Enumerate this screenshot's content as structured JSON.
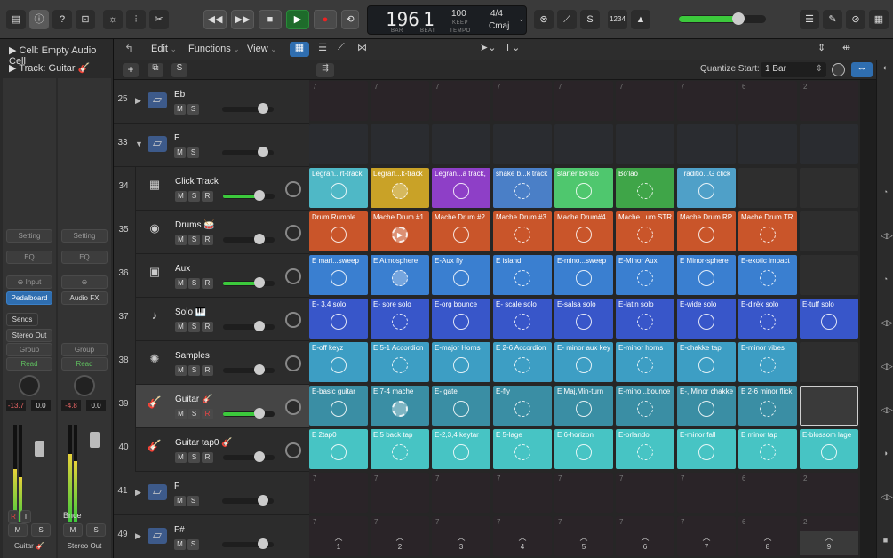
{
  "transport": {
    "bar": "196",
    "beat": "1",
    "bar_label": "BAR",
    "beat_label": "BEAT",
    "tempo": "100",
    "tempo_keep": "KEEP",
    "tempo_label": "TEMPO",
    "timesig": "4/4",
    "key": "Cmaj",
    "count_in": "1234",
    "master_volume": 0.68
  },
  "toolbar": {
    "edit": "Edit",
    "functions": "Functions",
    "view": "View"
  },
  "inspector": {
    "cell_label": "Cell: Empty Audio Cell",
    "track_label": "Track:",
    "track_value": "Guitar",
    "track_emoji": "🎸"
  },
  "channel_strip_1": {
    "setting": "Setting",
    "eq": "EQ",
    "input": "Input",
    "plugin": "Pedalboard",
    "sends": "Sends",
    "output": "Stereo Out",
    "group": "Group",
    "automation": "Read",
    "gain": "-13.7",
    "peak": "0.0",
    "r": "R",
    "i": "I",
    "m": "M",
    "s": "S",
    "name": "Guitar 🎸",
    "meter_level": 0.55
  },
  "channel_strip_2": {
    "setting": "Setting",
    "eq": "EQ",
    "plugin": "Audio FX",
    "group": "Group",
    "automation": "Read",
    "gain": "-4.8",
    "peak": "0.0",
    "bounce": "Bnce",
    "m": "M",
    "s": "S",
    "name": "Stereo Out",
    "meter_level": 0.7
  },
  "live_loops": {
    "quantize_label": "Quantize Start:",
    "quantize_value": "1 Bar"
  },
  "tracks": [
    {
      "num": "25",
      "name": "Eb",
      "type": "folder",
      "collapsed": true
    },
    {
      "num": "33",
      "name": "E",
      "type": "folder",
      "collapsed": false
    },
    {
      "num": "34",
      "name": "Click Track",
      "type": "track",
      "volume": 0.7,
      "active": true
    },
    {
      "num": "35",
      "name": "Drums 🥁",
      "type": "track",
      "volume": 0.7
    },
    {
      "num": "36",
      "name": "Aux",
      "type": "track",
      "volume": 0.7,
      "active": true
    },
    {
      "num": "37",
      "name": "Solo 🎹",
      "type": "track",
      "volume": 0.7
    },
    {
      "num": "38",
      "name": "Samples",
      "type": "track",
      "volume": 0.7
    },
    {
      "num": "39",
      "name": "Guitar 🎸",
      "type": "track",
      "volume": 0.7,
      "active": true,
      "selected": true
    },
    {
      "num": "40",
      "name": "Guitar tap0 🎸",
      "type": "track",
      "volume": 0.7
    },
    {
      "num": "41",
      "name": "F",
      "type": "folder",
      "collapsed": true
    },
    {
      "num": "49",
      "name": "F#",
      "type": "folder",
      "collapsed": true
    }
  ],
  "grid": {
    "folder_rows": {
      "row25": [
        "7",
        "7",
        "7",
        "7",
        "7",
        "7",
        "7",
        "6",
        "2"
      ],
      "row41": [
        "7",
        "7",
        "7",
        "7",
        "7",
        "7",
        "7",
        "6",
        "2"
      ],
      "row49": [
        "7",
        "7",
        "7",
        "7",
        "7",
        "7",
        "7",
        "6",
        "2"
      ]
    },
    "rows": [
      {
        "color": "#4fb8c6",
        "cells": [
          "Legran...rt-track",
          "Legran...k-track",
          "Legran...a track,",
          "shake b...k track",
          "starter Bo'lao",
          "Bo'lao",
          "Traditio...G click",
          null,
          null
        ],
        "colors": [
          "#4fb8c6",
          "#c9a227",
          "#8e3fc7",
          "#4a7fc7",
          "#4fc76e",
          "#3fa548",
          "#4fa0c8",
          null,
          null
        ]
      },
      {
        "color": "#c9552a",
        "cells": [
          "Drum Rumble",
          "Mache Drum #1",
          "Mache Drum #2",
          "Mache Drum #3",
          "Mache Drum#4",
          "Mache...um STR",
          "Mache Drum RP",
          "Mache Drum TR",
          null
        ],
        "colors": [
          "#c9552a",
          "#c9552a",
          "#c9552a",
          "#c9552a",
          "#c9552a",
          "#c9552a",
          "#c9552a",
          "#c9552a",
          null
        ]
      },
      {
        "color": "#3a7fd0",
        "cells": [
          "E mari...sweep",
          "E Atmosphere",
          "E-Aux fly",
          "E island",
          "E-mino...sweep",
          "E-Minor Aux",
          "E Minor-sphere",
          "E-exotic impact",
          null
        ],
        "colors": [
          "#3a7fd0",
          "#3a7fd0",
          "#3a7fd0",
          "#3a7fd0",
          "#3a7fd0",
          "#3a7fd0",
          "#3a7fd0",
          "#3a7fd0",
          null
        ]
      },
      {
        "color": "#3856c9",
        "cells": [
          "E- 3,4 solo",
          "E- sore solo",
          "E-org bounce",
          "E- scale solo",
          "E-salsa solo",
          "E-latin solo",
          "E-wide solo",
          "E-dirèk solo",
          "E-tuff solo"
        ],
        "colors": [
          "#3856c9",
          "#3856c9",
          "#3856c9",
          "#3856c9",
          "#3856c9",
          "#3856c9",
          "#3856c9",
          "#3856c9",
          "#3856c9"
        ]
      },
      {
        "color": "#3d9ec4",
        "cells": [
          "E-off keyz",
          "E 5-1 Accordion",
          "E-major Horns",
          "E 2-6 Accordion",
          "E- minor aux key",
          "E-minor horns",
          "E-chakke tap",
          "E-minor vibes",
          null
        ],
        "colors": [
          "#3d9ec4",
          "#3d9ec4",
          "#3d9ec4",
          "#3d9ec4",
          "#3d9ec4",
          "#3d9ec4",
          "#3d9ec4",
          "#3d9ec4",
          null
        ]
      },
      {
        "color": "#3a8ea4",
        "cells": [
          "E-basic guitar",
          "E 7-4 mache",
          "E- gate",
          "E-fly",
          "E Maj,Min-turn",
          "E-mino...bounce",
          "E-, Minor chakke",
          "E 2-6 minor flick",
          "__selected_empty__"
        ],
        "colors": [
          "#3a8ea4",
          "#3a8ea4",
          "#3a8ea4",
          "#3a8ea4",
          "#3a8ea4",
          "#3a8ea4",
          "#3a8ea4",
          "#3a8ea4",
          null
        ]
      },
      {
        "color": "#47c4c4",
        "cells": [
          "E 2tap0",
          "E 5 back tap",
          "E-2,3,4 keytar",
          "E 5-lage",
          "E 6-horizon",
          "E-orlando",
          "E-minor fall",
          "E minor tap",
          "E-blossom lage"
        ],
        "colors": [
          "#47c4c4",
          "#47c4c4",
          "#47c4c4",
          "#47c4c4",
          "#47c4c4",
          "#47c4c4",
          "#47c4c4",
          "#47c4c4",
          "#47c4c4"
        ]
      }
    ],
    "scene_numbers": [
      "1",
      "2",
      "3",
      "4",
      "5",
      "6",
      "7",
      "8",
      "9"
    ]
  }
}
